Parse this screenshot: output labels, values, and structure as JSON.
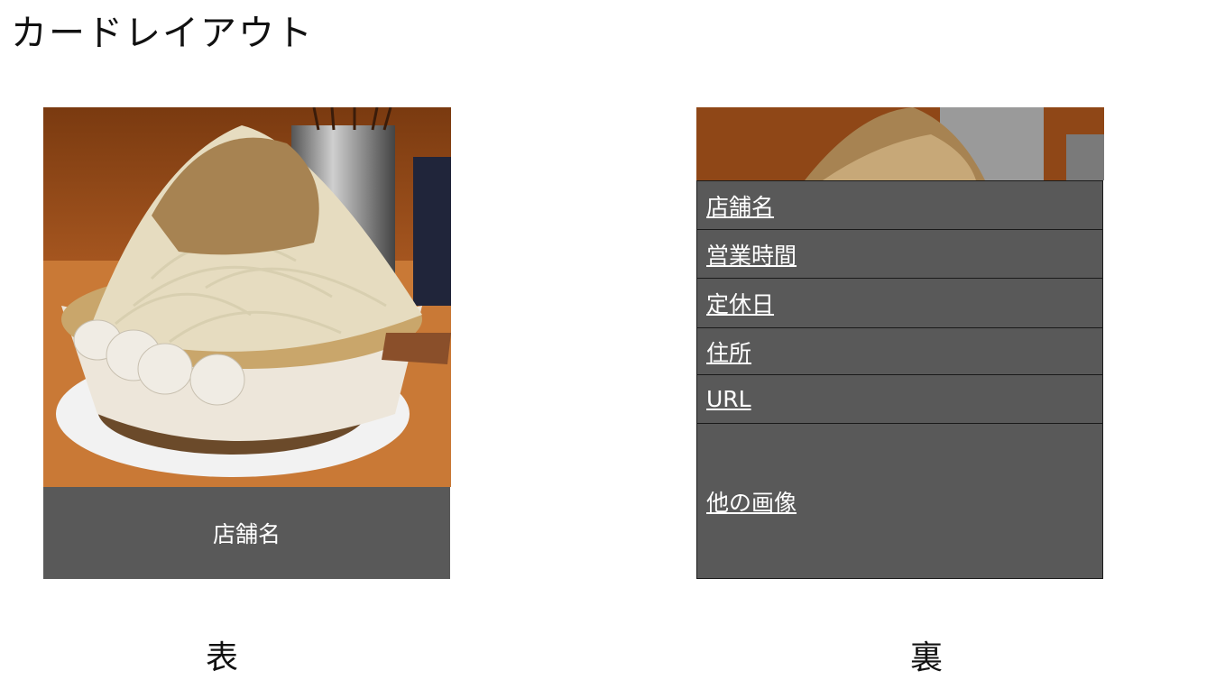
{
  "slide": {
    "title": "カードレイアウト"
  },
  "front": {
    "image": {
      "alt": "ramen-photo"
    },
    "shop_name": "店舗名",
    "caption": "表"
  },
  "back": {
    "image": {
      "alt": "ramen-photo-cropped"
    },
    "items": [
      "店舗名",
      "営業時間",
      "定休日",
      "住所",
      "URL",
      "他の画像"
    ],
    "caption": "裏"
  },
  "colors": {
    "panel": "#595959",
    "border": "#1a1a1a",
    "wood": "#a4551f"
  }
}
